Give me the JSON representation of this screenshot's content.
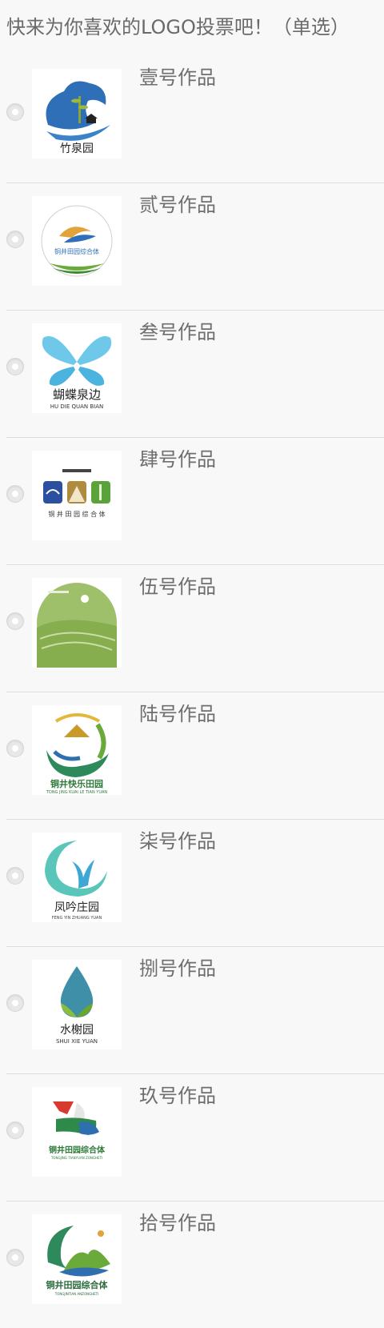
{
  "question": {
    "title": "快来为你喜欢的LOGO投票吧！（单选）"
  },
  "options": [
    {
      "label": "壹号作品",
      "logo": {
        "text": "竹泉园",
        "subtext": ""
      }
    },
    {
      "label": "贰号作品",
      "logo": {
        "text": "铜井田园综合体",
        "subtext": ""
      }
    },
    {
      "label": "叁号作品",
      "logo": {
        "text": "蝴蝶泉边",
        "subtext": "HU DIE QUAN BIAN"
      }
    },
    {
      "label": "肆号作品",
      "logo": {
        "text": "铜 井 田 园 综 合 体",
        "subtext": ""
      }
    },
    {
      "label": "伍号作品",
      "logo": {
        "text": "",
        "subtext": ""
      }
    },
    {
      "label": "陆号作品",
      "logo": {
        "text": "铜井快乐田园",
        "subtext": "TONG JING KUAI LE TIAN YUAN"
      }
    },
    {
      "label": "柒号作品",
      "logo": {
        "text": "凤吟庄园",
        "subtext": "FENG YIN ZHUANG YUAN"
      }
    },
    {
      "label": "捌号作品",
      "logo": {
        "text": "水榭园",
        "subtext": "SHUI XIE YUAN"
      }
    },
    {
      "label": "玖号作品",
      "logo": {
        "text": "铜井田园综合体",
        "subtext": "TONGJING TIANYUAN ZONGHETI"
      }
    },
    {
      "label": "拾号作品",
      "logo": {
        "text": "铜井田园综合体",
        "subtext": "TONGJINTIAN ANZONGHETI"
      }
    }
  ],
  "colors": {
    "background": "#f8f8f8",
    "text": "#6e6e6e",
    "divider": "#dcdcdc"
  }
}
